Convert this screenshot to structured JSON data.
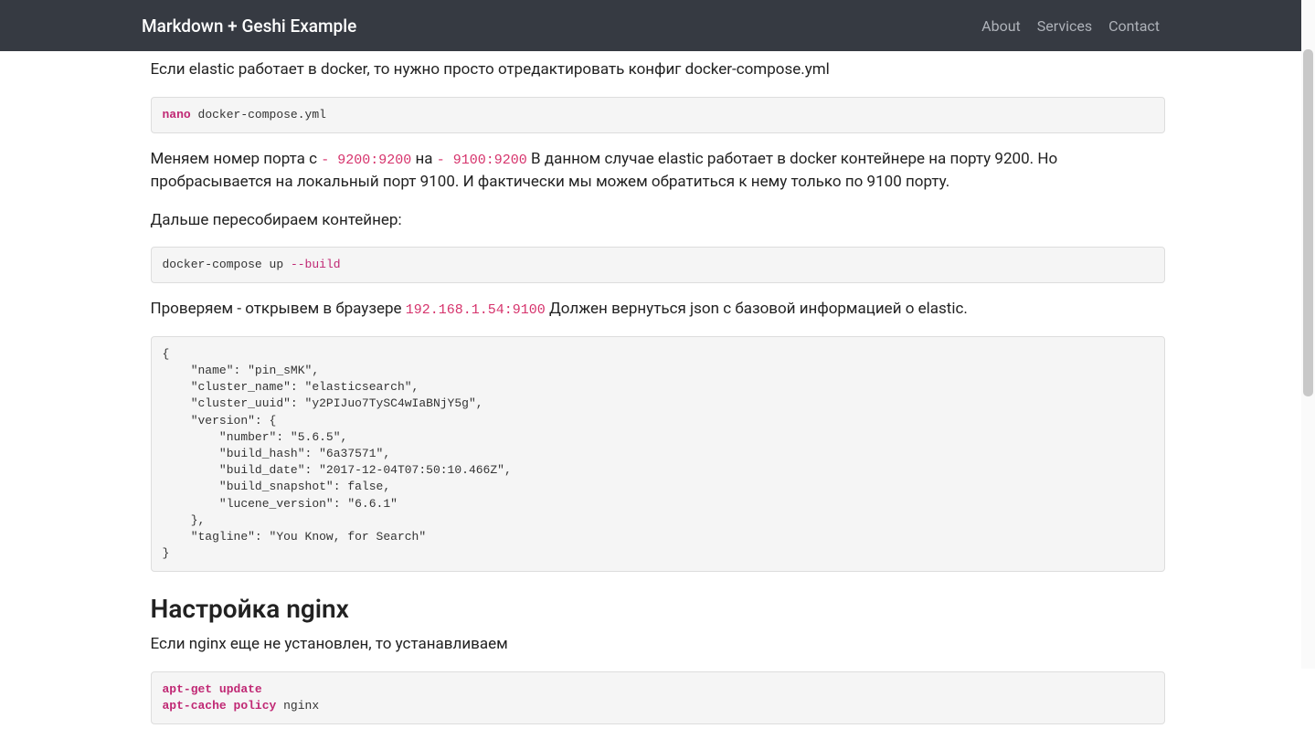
{
  "navbar": {
    "brand": "Markdown + Geshi Example",
    "links": [
      "About",
      "Services",
      "Contact"
    ]
  },
  "body": {
    "p1": "Если elastic работает в docker, то нужно просто отредактировать конфиг docker-compose.yml",
    "code1": {
      "cmd": "nano",
      "arg": " docker-compose.yml"
    },
    "p2": {
      "t1": "Меняем номер порта с ",
      "c1": "- 9200:9200",
      "t2": " на ",
      "c2": "- 9100:9200",
      "t3": " В данном случае elastic работает в docker контейнере на порту 9200. Но пробрасывается на локальный порт 9100. И фактически мы можем обратиться к нему только по 9100 порту."
    },
    "p3": "Дальше пересобираем контейнер:",
    "code2": {
      "pre": "docker-compose up ",
      "flag": "--build"
    },
    "p4": {
      "t1": "Проверяем - открывем в браузере ",
      "c1": "192.168.1.54:9100",
      "t2": " Должен вернуться json с базовой информацией о elastic."
    },
    "code3": "{\n    \"name\": \"pin_sMK\",\n    \"cluster_name\": \"elasticsearch\",\n    \"cluster_uuid\": \"y2PIJuo7TySC4wIaBNjY5g\",\n    \"version\": {\n        \"number\": \"5.6.5\",\n        \"build_hash\": \"6a37571\",\n        \"build_date\": \"2017-12-04T07:50:10.466Z\",\n        \"build_snapshot\": false,\n        \"lucene_version\": \"6.6.1\"\n    },\n    \"tagline\": \"You Know, for Search\"\n}",
    "h2_nginx": "Настройка nginx",
    "p5": "Если nginx еще не установлен, то устанавливаем",
    "code4": {
      "l1a": "apt-get",
      "l1b": " update",
      "l2a": "apt-cache",
      "l2b": " policy",
      "l2c": " nginx"
    }
  }
}
